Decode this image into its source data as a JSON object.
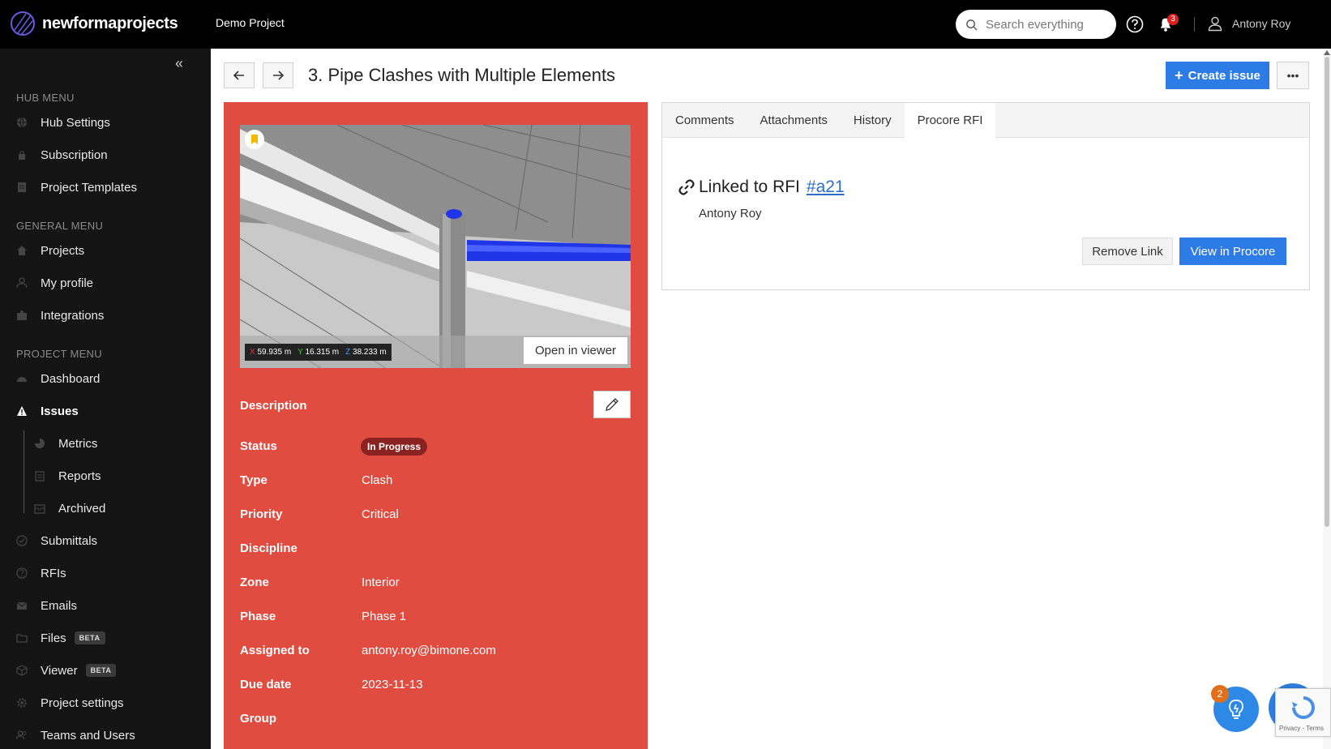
{
  "app": {
    "brand": "newformaprojects",
    "project": "Demo Project"
  },
  "header": {
    "search_placeholder": "Search everything",
    "notifications_count": "3",
    "user_name": "Antony Roy"
  },
  "sidebar": {
    "sections": {
      "hub": "HUB MENU",
      "general": "GENERAL MENU",
      "project": "PROJECT MENU"
    },
    "hub_items": [
      {
        "label": "Hub Settings",
        "icon": "globe-icon"
      },
      {
        "label": "Subscription",
        "icon": "subscription-icon"
      },
      {
        "label": "Project Templates",
        "icon": "document-icon"
      }
    ],
    "general_items": [
      {
        "label": "Projects",
        "icon": "home-icon"
      },
      {
        "label": "My profile",
        "icon": "user-icon"
      },
      {
        "label": "Integrations",
        "icon": "puzzle-icon"
      }
    ],
    "project_items": [
      {
        "label": "Dashboard",
        "icon": "dashboard-icon"
      },
      {
        "label": "Issues",
        "icon": "warning-icon",
        "active": true
      },
      {
        "label": "Submittals",
        "icon": "check-circle-icon"
      },
      {
        "label": "RFIs",
        "icon": "question-icon"
      },
      {
        "label": "Emails",
        "icon": "mail-icon"
      },
      {
        "label": "Files",
        "icon": "folder-icon",
        "badge": "BETA"
      },
      {
        "label": "Viewer",
        "icon": "cube-icon",
        "badge": "BETA"
      },
      {
        "label": "Project settings",
        "icon": "gear-icon"
      },
      {
        "label": "Teams and Users",
        "icon": "users-icon"
      }
    ],
    "issues_subitems": [
      {
        "label": "Metrics",
        "icon": "pie-chart-icon"
      },
      {
        "label": "Reports",
        "icon": "report-icon"
      },
      {
        "label": "Archived",
        "icon": "archive-icon"
      }
    ]
  },
  "issue": {
    "title": "3. Pipe Clashes with Multiple Elements",
    "create_label": "Create issue",
    "more_label": "•••",
    "snapshot": {
      "coords": {
        "x": "59.935 m",
        "y": "16.315 m",
        "z": "38.233 m"
      },
      "x_label": "X",
      "y_label": "Y",
      "z_label": "Z",
      "open_viewer_label": "Open in viewer"
    },
    "description_label": "Description",
    "properties": {
      "status_label": "Status",
      "status_value": "In Progress",
      "type_label": "Type",
      "type_value": "Clash",
      "priority_label": "Priority",
      "priority_value": "Critical",
      "discipline_label": "Discipline",
      "discipline_value": "",
      "zone_label": "Zone",
      "zone_value": "Interior",
      "phase_label": "Phase",
      "phase_value": "Phase 1",
      "assigned_label": "Assigned to",
      "assigned_value": "antony.roy@bimone.com",
      "due_label": "Due date",
      "due_value": "2023-11-13",
      "group_label": "Group",
      "group_value": ""
    }
  },
  "tabs": [
    {
      "label": "Comments"
    },
    {
      "label": "Attachments"
    },
    {
      "label": "History"
    },
    {
      "label": "Procore RFI",
      "active": true
    }
  ],
  "rfi": {
    "heading": "Linked to RFI",
    "link_text": "#a21",
    "linked_by": "Antony Roy",
    "remove_label": "Remove Link",
    "view_label": "View in Procore"
  },
  "floating": {
    "tips_badge": "2"
  },
  "recaptcha": {
    "text": "Privacy - Terms"
  },
  "colors": {
    "accent": "#2d7be5",
    "critical_panel": "#e04c40",
    "status_badge": "#8a2222",
    "sidebar_bg": "#141414",
    "topbar_bg": "#000000"
  }
}
